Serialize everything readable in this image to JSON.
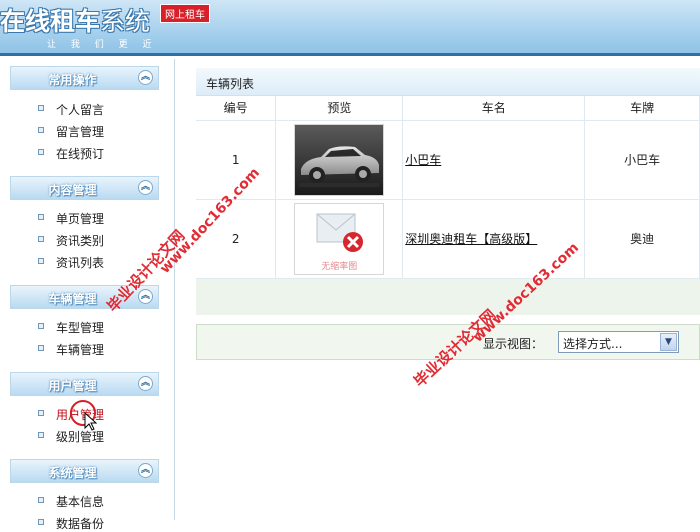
{
  "header": {
    "logo_bold": "在线租车",
    "logo_light": "系统",
    "badge": "网上租车",
    "slogan": "让 我 们 更 近"
  },
  "sidebar": {
    "groups": [
      {
        "title": "常用操作",
        "items": [
          "个人留言",
          "留言管理",
          "在线预订"
        ]
      },
      {
        "title": "内容管理",
        "items": [
          "单页管理",
          "资讯类别",
          "资讯列表"
        ]
      },
      {
        "title": "车辆管理",
        "items": [
          "车型管理",
          "车辆管理"
        ]
      },
      {
        "title": "用户管理",
        "items": [
          "用户管理",
          "级别管理"
        ]
      },
      {
        "title": "系统管理",
        "items": [
          "基本信息",
          "数据备份"
        ]
      }
    ],
    "collapse_icon": "chevron-up-icon",
    "active_item": "用户管理"
  },
  "main": {
    "panel_title": "车辆列表",
    "columns": [
      "编号",
      "预览",
      "车名",
      "车牌"
    ],
    "rows": [
      {
        "id": "1",
        "name": "小巴车",
        "plate": "小巴车",
        "thumb": "car-photo"
      },
      {
        "id": "2",
        "name": "深圳奥迪租车【高级版】",
        "plate": "奥迪",
        "thumb": "no-image-placeholder"
      }
    ],
    "no_image_text": "无缩率图",
    "view_label": "显示视图：",
    "view_select": "选择方式..."
  },
  "watermarks": {
    "line1": "毕业设计论文网",
    "line2": "www.doc163.com"
  },
  "colors": {
    "accent": "#2f6fa8",
    "watermark": "#e0212a",
    "badge": "#d8202a"
  }
}
